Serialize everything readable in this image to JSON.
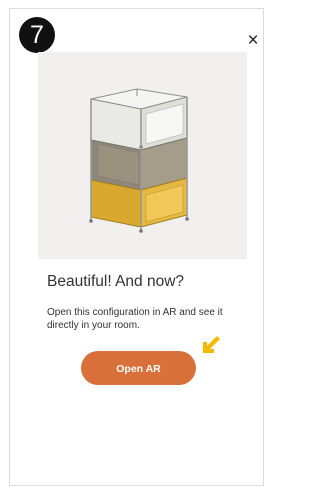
{
  "step": {
    "number": "7"
  },
  "dialog": {
    "close_glyph": "×",
    "heading": "Beautiful! And now?",
    "description": "Open this configuration in AR and see it directly in your room.",
    "open_ar_label": "Open AR"
  },
  "colors": {
    "accent_button": "#d9703a",
    "hint_arrow": "#f5b800",
    "shelf_top": "#e6e6e2",
    "shelf_middle": "#a49c88",
    "shelf_bottom": "#e2b43a"
  },
  "icons": {
    "close": "close-icon",
    "hint": "arrow-pointer-icon"
  }
}
